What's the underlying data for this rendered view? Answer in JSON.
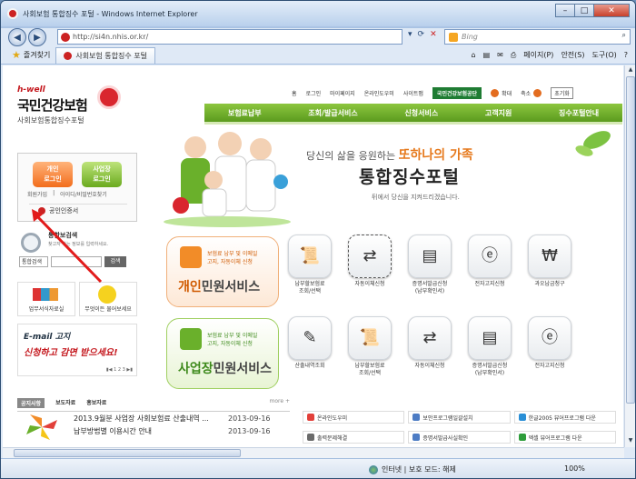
{
  "window": {
    "title": "사회보험 통합징수 포털 - Windows Internet Explorer"
  },
  "address": {
    "host": "si4n.nhis.or.kr",
    "full": "http://si4n.nhis.or.kr/"
  },
  "search": {
    "placeholder": "Bing"
  },
  "favorites": {
    "label": "즐겨찾기"
  },
  "tab": {
    "label": "사회보험 통합징수 포털"
  },
  "commands": [
    "페이지(P)",
    "안전(S)",
    "도구(O)"
  ],
  "site": {
    "logo": {
      "tag": "h-well",
      "name": "국민건강보험",
      "sub": "사회보험통합징수포털"
    },
    "util": {
      "home": "홈",
      "login": "로그인",
      "mypage": "마이페이지",
      "onlinehelp": "온라인도우미",
      "sitemap": "사이트맵",
      "nhis": "국민건강보험공단",
      "zoom_in": "확대",
      "zoom_out": "축소",
      "close_all": "초기화"
    },
    "gnb": [
      "보험료납부",
      "조회/발급서비스",
      "신청서비스",
      "고객지원",
      "징수포털안내"
    ],
    "login": {
      "personal_1": "개인",
      "personal_2": "로그인",
      "biz_1": "사업장",
      "biz_2": "로그인",
      "join": "회원가입",
      "find": "아이디/비밀번호찾기",
      "cert": "공인인증서"
    },
    "intsearch": {
      "title": "통합보검색",
      "desc": "찾고자 하는 정보를 입력하세요.",
      "select": "통합검색",
      "button": "검색"
    },
    "quick": [
      {
        "label": "업무서식자료실"
      },
      {
        "label": "무엇이든 물어보세요"
      }
    ],
    "banner": {
      "line1": "E-mail 고지",
      "line2": "신청하고 감면 받으세요!",
      "pager": "▮◀ 1 2 3 ▶▮"
    },
    "hero": {
      "tagline_a": "당신의 삶을 응원하는",
      "tagline_b": "또하나의 가족",
      "portal": "통합징수포털",
      "sub": "뒤에서 당신을 지켜드리겠습니다."
    },
    "personal": {
      "desc1": "보험료 납부 및 이메일",
      "desc2": "고지, 자동이체 신청",
      "big_a": "개인",
      "big_b": "민원서비스"
    },
    "biz": {
      "desc1": "보험료 납부 및 이메일",
      "desc2": "고지, 자동이체 신청",
      "big_a": "사업장",
      "big_b": "민원서비스"
    },
    "personal_services": [
      {
        "l1": "납부할보험료",
        "l2": "조회/선택",
        "icon": "document-icon"
      },
      {
        "l1": "자동이체신청",
        "l2": "",
        "icon": "transfer-icon"
      },
      {
        "l1": "증명서발급신청",
        "l2": "(납부확인서)",
        "icon": "certificate-icon"
      },
      {
        "l1": "전자고지신청",
        "l2": "",
        "icon": "e-notice-icon"
      },
      {
        "l1": "과오납금청구",
        "l2": "",
        "icon": "refund-icon"
      }
    ],
    "biz_services": [
      {
        "l1": "산출내역조회",
        "l2": "",
        "icon": "pencil-icon"
      },
      {
        "l1": "납부할보험료",
        "l2": "조회/선택",
        "icon": "document-icon"
      },
      {
        "l1": "자동이체신청",
        "l2": "",
        "icon": "transfer-icon"
      },
      {
        "l1": "증명서발급신청",
        "l2": "(납부확인서)",
        "icon": "certificate-icon"
      },
      {
        "l1": "전자고지신청",
        "l2": "",
        "icon": "e-notice-icon"
      }
    ],
    "news": {
      "tabs": [
        "공지사항",
        "보도자료",
        "홍보자료"
      ],
      "more": "more +",
      "items": [
        {
          "title": "2013.9월분 사업장 사회보험료 산출내역 ...",
          "date": "2013-09-16"
        },
        {
          "title": "납부방법별 이용시간 안내",
          "date": "2013-09-16"
        }
      ]
    },
    "links": [
      {
        "label": "온라인도우미",
        "color": "#e2403a"
      },
      {
        "label": "보안프로그램일괄설치",
        "color": "#4d7cc4"
      },
      {
        "label": "한글2005 뷰어프로그램 다운",
        "color": "#2a8fd6"
      },
      {
        "label": "출력문제해결",
        "color": "#6a6a6a"
      },
      {
        "label": "증명서발급사실확인",
        "color": "#4d7cc4"
      },
      {
        "label": "엑셀 뷰어프로그램 다운",
        "color": "#2e9d3b"
      }
    ]
  },
  "status": {
    "zone": "인터넷 | 보호 모드: 해제",
    "zoom": "100%"
  }
}
